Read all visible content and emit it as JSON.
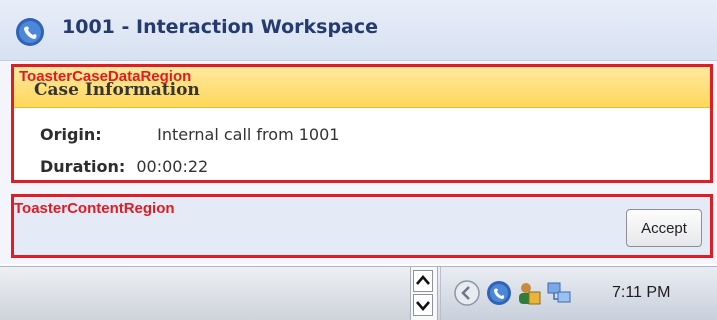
{
  "window": {
    "title": "1001 - Interaction Workspace",
    "icon": "interaction-workspace-icon"
  },
  "case_region": {
    "annotation": "ToasterCaseDataRegion",
    "header_title": "Case Information",
    "fields": [
      {
        "label": "Origin:",
        "value": "Internal call from 1001"
      },
      {
        "label": "Duration:",
        "value": "00:00:22"
      }
    ]
  },
  "content_region": {
    "annotation": "ToasterContentRegion",
    "accept_label": "Accept"
  },
  "taskbar": {
    "tray_icons": [
      "back-arrow-icon",
      "interaction-workspace-icon",
      "users-icon",
      "network-icon"
    ],
    "clock": "7:11 PM"
  },
  "colors": {
    "annotation_border": "#e01c24",
    "title_text": "#253a6e",
    "case_header": "#ffd75a"
  }
}
